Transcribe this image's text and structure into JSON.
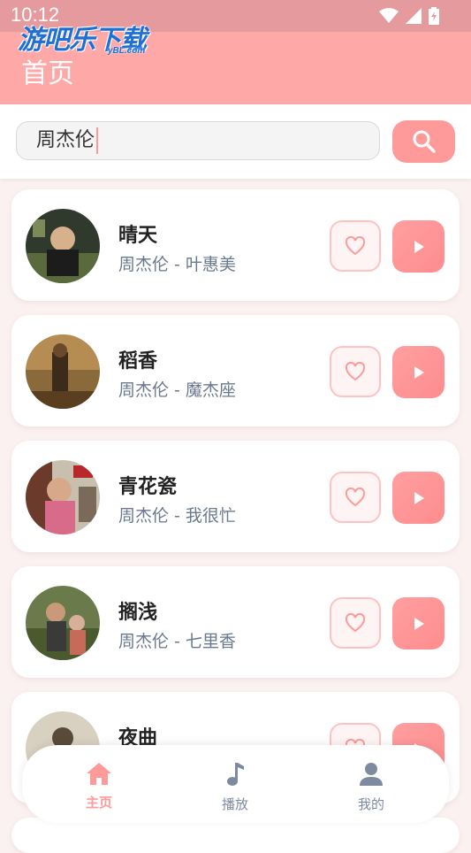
{
  "status_bar": {
    "time": "10:12"
  },
  "watermark": {
    "main": "游吧乐下载",
    "sub": "yBL.com"
  },
  "header": {
    "title": "首页"
  },
  "search": {
    "value": "周杰伦"
  },
  "songs": [
    {
      "title": "晴天",
      "artist_line": "周杰伦 - 叶惠美"
    },
    {
      "title": "稻香",
      "artist_line": "周杰伦 - 魔杰座"
    },
    {
      "title": "青花瓷",
      "artist_line": "周杰伦 - 我很忙"
    },
    {
      "title": "搁浅",
      "artist_line": "周杰伦 - 七里香"
    },
    {
      "title": "夜曲",
      "artist_line": ""
    }
  ],
  "nav": {
    "home": "主页",
    "play": "播放",
    "mine": "我的"
  },
  "colors": {
    "accent": "#ff9a9a",
    "header": "#ffa8a8",
    "muted": "#7e8aa0"
  }
}
